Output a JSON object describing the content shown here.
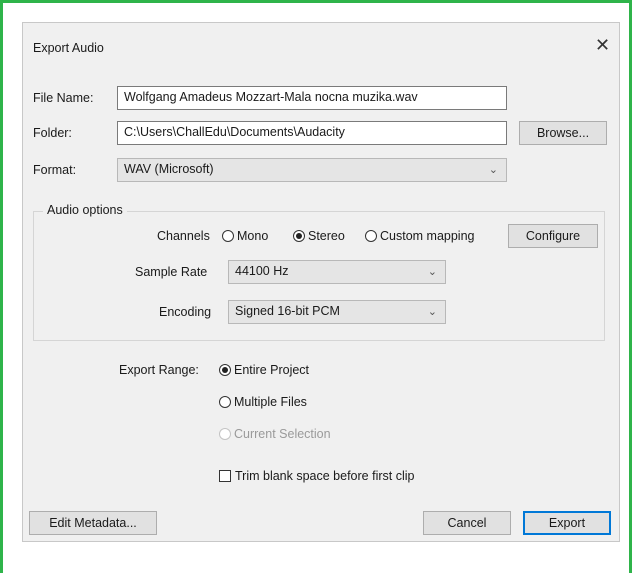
{
  "dialog": {
    "title": "Export Audio",
    "close_glyph": "✕"
  },
  "file": {
    "name_label": "File Name:",
    "name_value": "Wolfgang Amadeus Mozzart-Mala nocna muzika.wav",
    "folder_label": "Folder:",
    "folder_value": "C:\\Users\\ChallEdu\\Documents\\Audacity",
    "browse_label": "Browse...",
    "format_label": "Format:",
    "format_value": "WAV (Microsoft)"
  },
  "audio_options": {
    "title": "Audio options",
    "channels_label": "Channels",
    "channel_options": [
      "Mono",
      "Stereo",
      "Custom mapping"
    ],
    "channel_selected": "Stereo",
    "configure_label": "Configure",
    "sample_rate_label": "Sample Rate",
    "sample_rate_value": "44100 Hz",
    "encoding_label": "Encoding",
    "encoding_value": "Signed 16-bit PCM"
  },
  "export_range": {
    "label": "Export Range:",
    "options": [
      "Entire Project",
      "Multiple Files",
      "Current Selection"
    ],
    "selected": "Entire Project",
    "disabled": "Current Selection"
  },
  "trim": {
    "label": "Trim blank space before first clip",
    "checked": false
  },
  "footer": {
    "edit_metadata_label": "Edit Metadata...",
    "cancel_label": "Cancel",
    "export_label": "Export"
  },
  "colors": {
    "frame": "#2fb44a",
    "dialog_bg": "#f0f0f0",
    "default_button_border": "#0078d7"
  },
  "icons": {
    "close": "close-icon",
    "dropdown": "chevron-down-icon"
  }
}
